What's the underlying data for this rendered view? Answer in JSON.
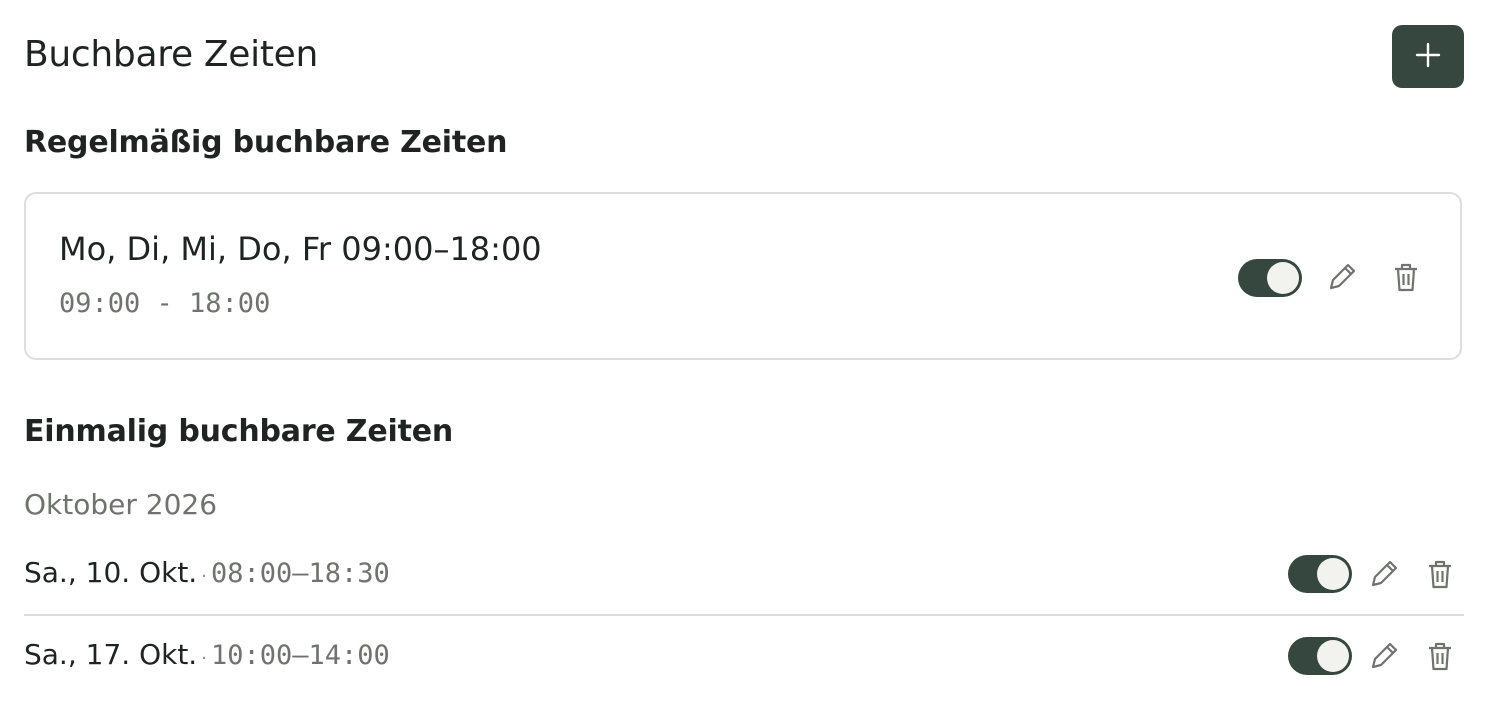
{
  "header": {
    "title": "Buchbare Zeiten",
    "add_icon": "plus-icon"
  },
  "colors": {
    "primary": "#36473f",
    "muted": "#6f726f",
    "border": "#dededc"
  },
  "regular": {
    "title": "Regelmäßig buchbare Zeiten",
    "items": [
      {
        "title": "Mo, Di, Mi, Do, Fr 09:00–18:00",
        "time": "09:00 - 18:00",
        "enabled": true
      }
    ]
  },
  "one_time": {
    "title": "Einmalig buchbare Zeiten",
    "month": "Oktober 2026",
    "separator": "·",
    "items": [
      {
        "date": "Sa., 10. Okt.",
        "time": "08:00–18:30",
        "enabled": true
      },
      {
        "date": "Sa., 17. Okt.",
        "time": "10:00–14:00",
        "enabled": true
      }
    ]
  }
}
